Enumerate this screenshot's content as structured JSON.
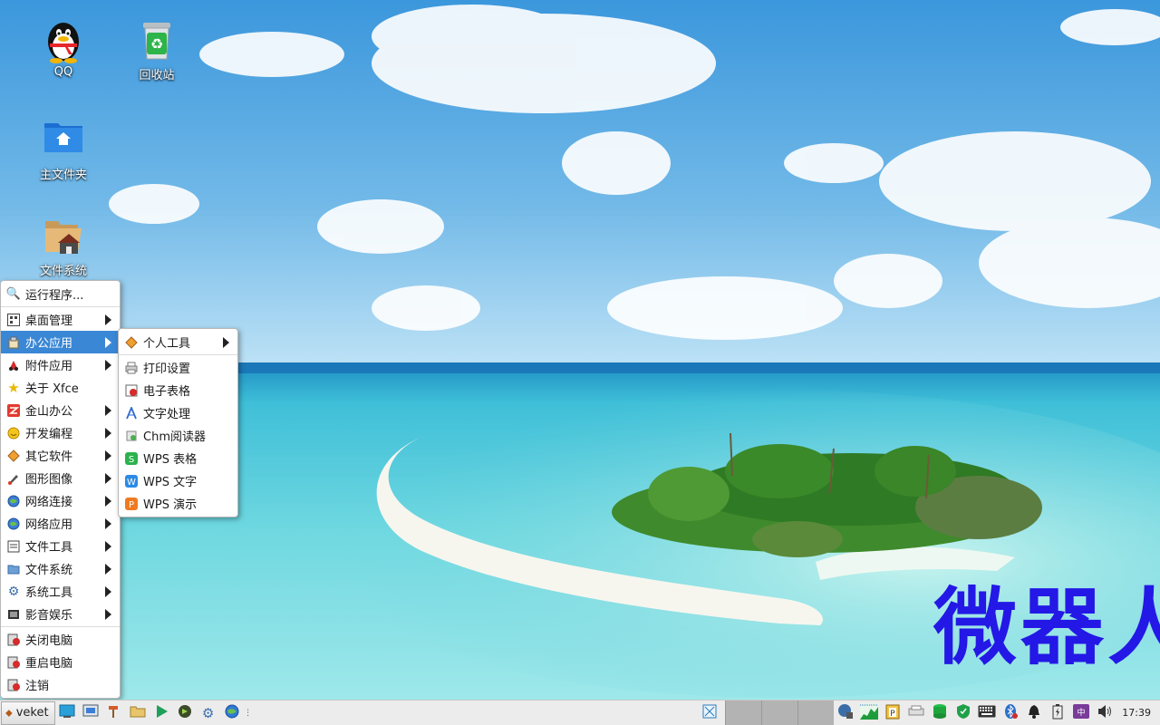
{
  "desktop": {
    "icons": [
      {
        "label": "QQ",
        "icon": "qq-penguin-icon"
      },
      {
        "label": "回收站",
        "icon": "recycle-bin-icon"
      },
      {
        "label": "主文件夹",
        "icon": "home-folder-icon"
      },
      {
        "label": "文件系统",
        "icon": "filesystem-icon"
      }
    ],
    "watermark": "微器人"
  },
  "app_menu": {
    "items": [
      {
        "label": "运行程序...",
        "icon": "run-icon",
        "submenu": false
      },
      {
        "label": "桌面管理",
        "icon": "desktop-icon",
        "submenu": true
      },
      {
        "label": "办公应用",
        "icon": "office-icon",
        "submenu": true,
        "selected": true
      },
      {
        "label": "附件应用",
        "icon": "accessories-icon",
        "submenu": true
      },
      {
        "label": "关于 Xfce",
        "icon": "star-icon",
        "submenu": false
      },
      {
        "label": "金山办公",
        "icon": "wps-icon",
        "submenu": true
      },
      {
        "label": "开发编程",
        "icon": "develop-icon",
        "submenu": true
      },
      {
        "label": "其它软件",
        "icon": "other-icon",
        "submenu": true
      },
      {
        "label": "图形图像",
        "icon": "graphics-icon",
        "submenu": true
      },
      {
        "label": "网络连接",
        "icon": "network-icon",
        "submenu": true
      },
      {
        "label": "网络应用",
        "icon": "internet-icon",
        "submenu": true
      },
      {
        "label": "文件工具",
        "icon": "file-tools-icon",
        "submenu": true
      },
      {
        "label": "文件系统",
        "icon": "folder-icon",
        "submenu": true
      },
      {
        "label": "系统工具",
        "icon": "system-icon",
        "submenu": true
      },
      {
        "label": "影音娱乐",
        "icon": "multimedia-icon",
        "submenu": true
      },
      {
        "label": "关闭电脑",
        "icon": "shutdown-icon",
        "submenu": false
      },
      {
        "label": "重启电脑",
        "icon": "reboot-icon",
        "submenu": false
      },
      {
        "label": "注销",
        "icon": "logout-icon",
        "submenu": false
      }
    ]
  },
  "office_submenu": {
    "items": [
      {
        "label": "个人工具",
        "icon": "personal-tools-icon",
        "submenu": true
      },
      {
        "label": "打印设置",
        "icon": "printer-icon",
        "submenu": false
      },
      {
        "label": "电子表格",
        "icon": "spreadsheet-icon",
        "submenu": false
      },
      {
        "label": "文字处理",
        "icon": "writer-icon",
        "submenu": false
      },
      {
        "label": "Chm阅读器",
        "icon": "chm-icon",
        "submenu": false
      },
      {
        "label": "WPS 表格",
        "icon": "wps-et-icon",
        "submenu": false
      },
      {
        "label": "WPS 文字",
        "icon": "wps-writer-icon",
        "submenu": false
      },
      {
        "label": "WPS 演示",
        "icon": "wps-presentation-icon",
        "submenu": false
      }
    ]
  },
  "taskbar": {
    "start_label": "veket",
    "clock": "17:39",
    "colors": {
      "selection": "#3a87d6",
      "watermark": "#2418e6"
    }
  }
}
